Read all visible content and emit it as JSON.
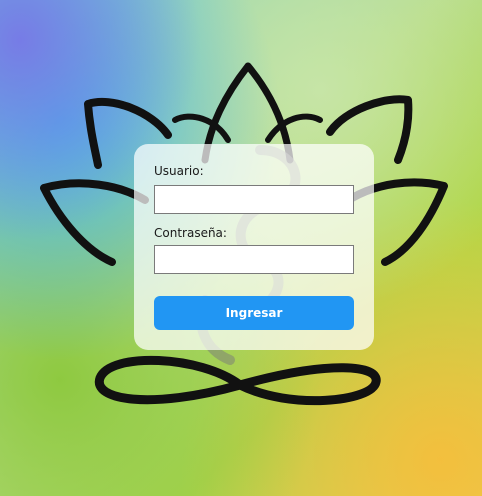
{
  "background": {
    "image_name": "lotus-background",
    "colors": [
      "#7fd0d8",
      "#b8dd8a",
      "#a8d44f",
      "#e8d258"
    ]
  },
  "login": {
    "username_label": "Usuario:",
    "username_value": "",
    "password_label": "Contraseña:",
    "password_value": "",
    "submit_label": "Ingresar",
    "accent_color": "#2196f3"
  }
}
